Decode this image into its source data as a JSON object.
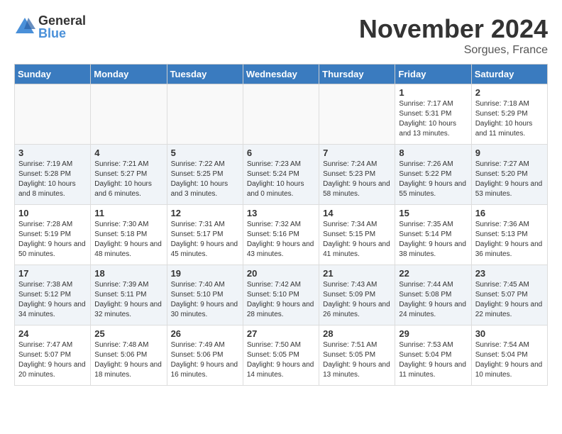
{
  "logo": {
    "general": "General",
    "blue": "Blue"
  },
  "title": "November 2024",
  "subtitle": "Sorgues, France",
  "days": [
    "Sunday",
    "Monday",
    "Tuesday",
    "Wednesday",
    "Thursday",
    "Friday",
    "Saturday"
  ],
  "weeks": [
    [
      {
        "day": "",
        "info": ""
      },
      {
        "day": "",
        "info": ""
      },
      {
        "day": "",
        "info": ""
      },
      {
        "day": "",
        "info": ""
      },
      {
        "day": "",
        "info": ""
      },
      {
        "day": "1",
        "info": "Sunrise: 7:17 AM\nSunset: 5:31 PM\nDaylight: 10 hours and 13 minutes."
      },
      {
        "day": "2",
        "info": "Sunrise: 7:18 AM\nSunset: 5:29 PM\nDaylight: 10 hours and 11 minutes."
      }
    ],
    [
      {
        "day": "3",
        "info": "Sunrise: 7:19 AM\nSunset: 5:28 PM\nDaylight: 10 hours and 8 minutes."
      },
      {
        "day": "4",
        "info": "Sunrise: 7:21 AM\nSunset: 5:27 PM\nDaylight: 10 hours and 6 minutes."
      },
      {
        "day": "5",
        "info": "Sunrise: 7:22 AM\nSunset: 5:25 PM\nDaylight: 10 hours and 3 minutes."
      },
      {
        "day": "6",
        "info": "Sunrise: 7:23 AM\nSunset: 5:24 PM\nDaylight: 10 hours and 0 minutes."
      },
      {
        "day": "7",
        "info": "Sunrise: 7:24 AM\nSunset: 5:23 PM\nDaylight: 9 hours and 58 minutes."
      },
      {
        "day": "8",
        "info": "Sunrise: 7:26 AM\nSunset: 5:22 PM\nDaylight: 9 hours and 55 minutes."
      },
      {
        "day": "9",
        "info": "Sunrise: 7:27 AM\nSunset: 5:20 PM\nDaylight: 9 hours and 53 minutes."
      }
    ],
    [
      {
        "day": "10",
        "info": "Sunrise: 7:28 AM\nSunset: 5:19 PM\nDaylight: 9 hours and 50 minutes."
      },
      {
        "day": "11",
        "info": "Sunrise: 7:30 AM\nSunset: 5:18 PM\nDaylight: 9 hours and 48 minutes."
      },
      {
        "day": "12",
        "info": "Sunrise: 7:31 AM\nSunset: 5:17 PM\nDaylight: 9 hours and 45 minutes."
      },
      {
        "day": "13",
        "info": "Sunrise: 7:32 AM\nSunset: 5:16 PM\nDaylight: 9 hours and 43 minutes."
      },
      {
        "day": "14",
        "info": "Sunrise: 7:34 AM\nSunset: 5:15 PM\nDaylight: 9 hours and 41 minutes."
      },
      {
        "day": "15",
        "info": "Sunrise: 7:35 AM\nSunset: 5:14 PM\nDaylight: 9 hours and 38 minutes."
      },
      {
        "day": "16",
        "info": "Sunrise: 7:36 AM\nSunset: 5:13 PM\nDaylight: 9 hours and 36 minutes."
      }
    ],
    [
      {
        "day": "17",
        "info": "Sunrise: 7:38 AM\nSunset: 5:12 PM\nDaylight: 9 hours and 34 minutes."
      },
      {
        "day": "18",
        "info": "Sunrise: 7:39 AM\nSunset: 5:11 PM\nDaylight: 9 hours and 32 minutes."
      },
      {
        "day": "19",
        "info": "Sunrise: 7:40 AM\nSunset: 5:10 PM\nDaylight: 9 hours and 30 minutes."
      },
      {
        "day": "20",
        "info": "Sunrise: 7:42 AM\nSunset: 5:10 PM\nDaylight: 9 hours and 28 minutes."
      },
      {
        "day": "21",
        "info": "Sunrise: 7:43 AM\nSunset: 5:09 PM\nDaylight: 9 hours and 26 minutes."
      },
      {
        "day": "22",
        "info": "Sunrise: 7:44 AM\nSunset: 5:08 PM\nDaylight: 9 hours and 24 minutes."
      },
      {
        "day": "23",
        "info": "Sunrise: 7:45 AM\nSunset: 5:07 PM\nDaylight: 9 hours and 22 minutes."
      }
    ],
    [
      {
        "day": "24",
        "info": "Sunrise: 7:47 AM\nSunset: 5:07 PM\nDaylight: 9 hours and 20 minutes."
      },
      {
        "day": "25",
        "info": "Sunrise: 7:48 AM\nSunset: 5:06 PM\nDaylight: 9 hours and 18 minutes."
      },
      {
        "day": "26",
        "info": "Sunrise: 7:49 AM\nSunset: 5:06 PM\nDaylight: 9 hours and 16 minutes."
      },
      {
        "day": "27",
        "info": "Sunrise: 7:50 AM\nSunset: 5:05 PM\nDaylight: 9 hours and 14 minutes."
      },
      {
        "day": "28",
        "info": "Sunrise: 7:51 AM\nSunset: 5:05 PM\nDaylight: 9 hours and 13 minutes."
      },
      {
        "day": "29",
        "info": "Sunrise: 7:53 AM\nSunset: 5:04 PM\nDaylight: 9 hours and 11 minutes."
      },
      {
        "day": "30",
        "info": "Sunrise: 7:54 AM\nSunset: 5:04 PM\nDaylight: 9 hours and 10 minutes."
      }
    ]
  ]
}
